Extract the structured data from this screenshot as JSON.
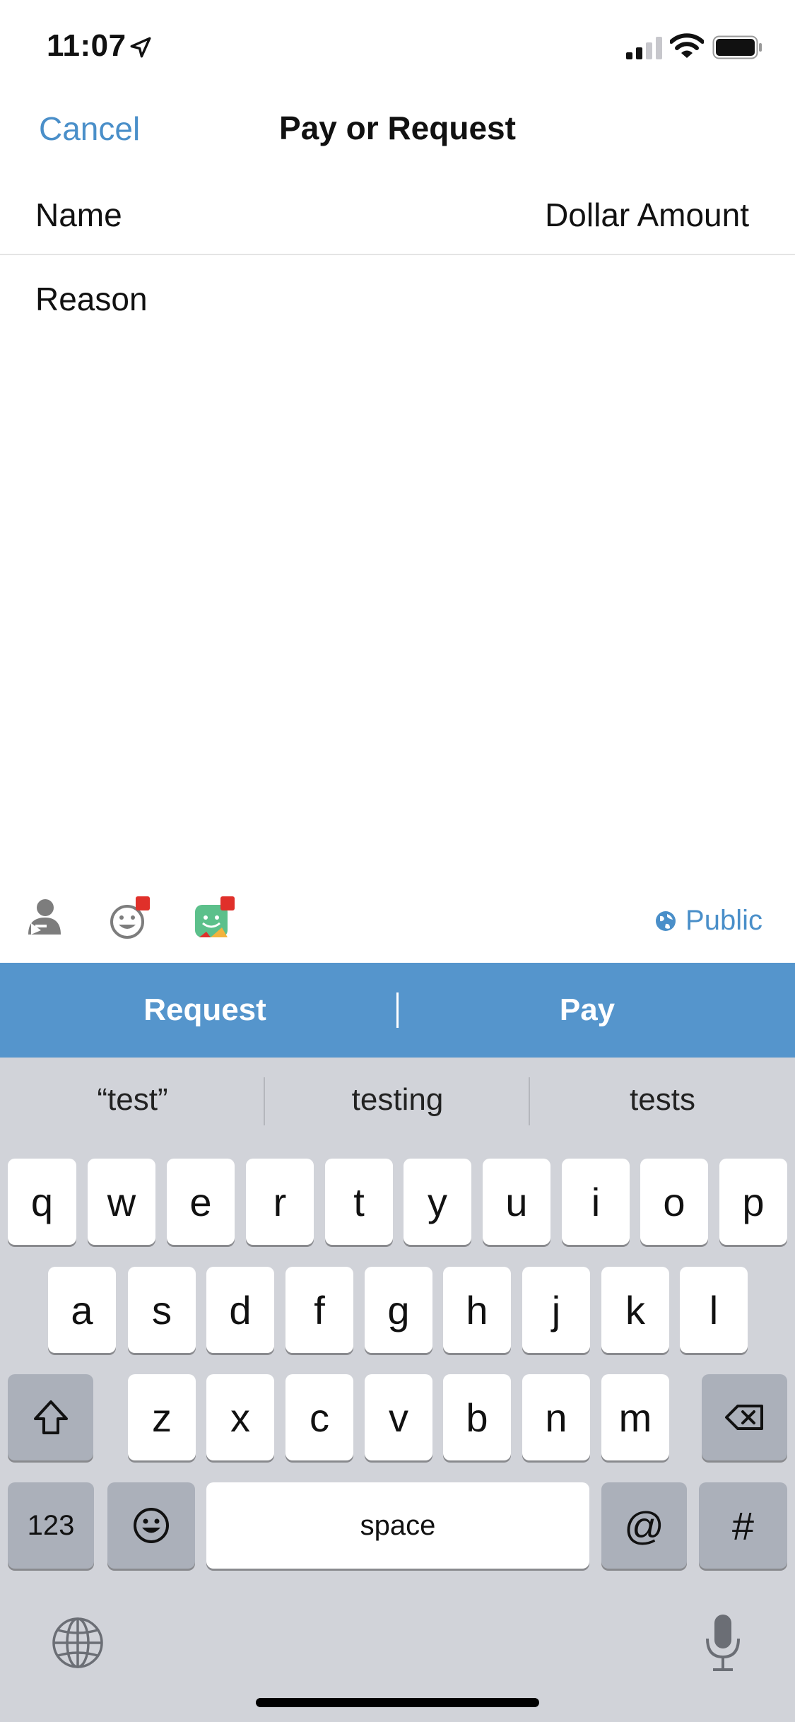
{
  "status_bar": {
    "time": "11:07",
    "icons": [
      "location-arrow-icon",
      "signal-icon",
      "wifi-icon",
      "battery-icon"
    ]
  },
  "nav": {
    "cancel_label": "Cancel",
    "title": "Pay or Request"
  },
  "form": {
    "name_placeholder": "Name",
    "amount_placeholder": "Dollar Amount",
    "reason_placeholder": "Reason"
  },
  "toolbar": {
    "icons": [
      "contact-icon",
      "emoji-icon",
      "sticker-icon"
    ],
    "privacy_label": "Public"
  },
  "actions": {
    "request_label": "Request",
    "pay_label": "Pay"
  },
  "keyboard": {
    "suggestions": [
      "“test”",
      "testing",
      "tests"
    ],
    "row1": [
      "q",
      "w",
      "e",
      "r",
      "t",
      "y",
      "u",
      "i",
      "o",
      "p"
    ],
    "row2": [
      "a",
      "s",
      "d",
      "f",
      "g",
      "h",
      "j",
      "k",
      "l"
    ],
    "row3": [
      "z",
      "x",
      "c",
      "v",
      "b",
      "n",
      "m"
    ],
    "numbers_label": "123",
    "space_label": "space",
    "at_label": "@",
    "hash_label": "#"
  },
  "colors": {
    "accent": "#4a8fc9",
    "action_bar": "#5595cc",
    "badge": "#e0302a",
    "keyboard_bg": "#d1d3d9"
  }
}
